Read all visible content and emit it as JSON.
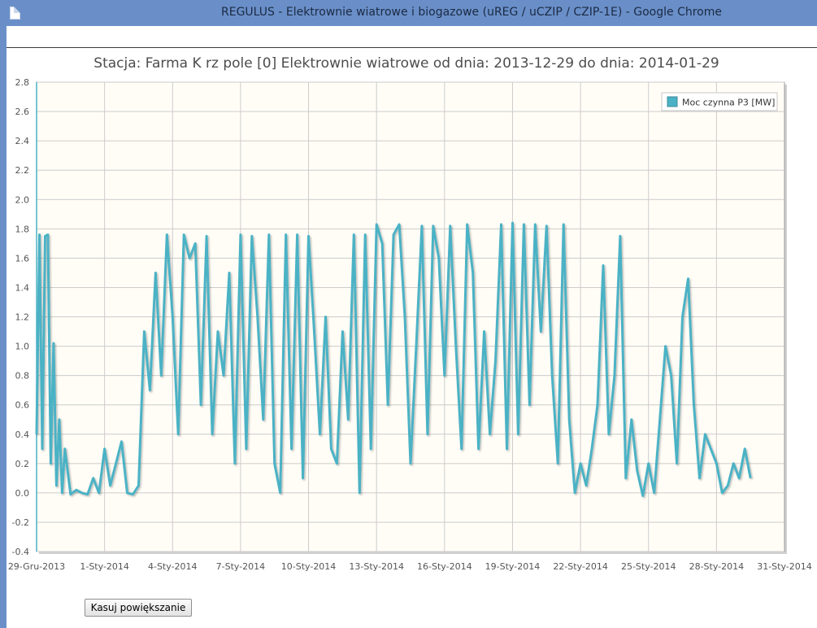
{
  "window": {
    "title": "REGULUS - Elektrownie wiatrowe i biogazowe (uREG / uCZIP / CZIP-1E) - Google Chrome"
  },
  "page": {
    "reset_zoom_label": "Kasuj powiększanie"
  },
  "colors": {
    "series": "#4bb2c5",
    "plot_bg": "#fffdf6",
    "grid": "#cccccc"
  },
  "chart_data": {
    "type": "line",
    "title": "Stacja: Farma K    rz pole [0] Elektrownie wiatrowe od dnia: 2013-12-29 do dnia: 2014-01-29",
    "xlabel": "",
    "ylabel": "",
    "xlim": [
      "2013-12-29",
      "2014-01-31"
    ],
    "ylim": [
      -0.4,
      2.8
    ],
    "grid": true,
    "legend": "top-right",
    "y_ticks": [
      "2.8",
      "2.6",
      "2.4",
      "2.2",
      "2.0",
      "1.8",
      "1.6",
      "1.4",
      "1.2",
      "1.0",
      "0.8",
      "0.6",
      "0.4",
      "0.2",
      "0.0",
      "-0.2",
      "-0.4"
    ],
    "x_ticks": [
      "29-Gru-2013",
      "1-Sty-2014",
      "4-Sty-2014",
      "7-Sty-2014",
      "10-Sty-2014",
      "13-Sty-2014",
      "16-Sty-2014",
      "19-Sty-2014",
      "22-Sty-2014",
      "25-Sty-2014",
      "28-Sty-2014",
      "31-Sty-2014"
    ],
    "series": [
      {
        "name": "Moc czynna P3 [MW]",
        "x": [
          "2013-12-29 00:00",
          "2013-12-29 03:00",
          "2013-12-29 06:00",
          "2013-12-29 09:00",
          "2013-12-29 12:00",
          "2013-12-29 15:00",
          "2013-12-29 18:00",
          "2013-12-29 21:00",
          "2013-12-30 00:00",
          "2013-12-30 03:00",
          "2013-12-30 06:00",
          "2013-12-30 12:00",
          "2013-12-30 18:00",
          "2013-12-31 00:00",
          "2013-12-31 06:00",
          "2013-12-31 12:00",
          "2013-12-31 18:00",
          "2014-01-01 00:00",
          "2014-01-01 06:00",
          "2014-01-01 12:00",
          "2014-01-01 18:00",
          "2014-01-02 00:00",
          "2014-01-02 06:00",
          "2014-01-02 12:00",
          "2014-01-02 18:00",
          "2014-01-03 00:00",
          "2014-01-03 06:00",
          "2014-01-03 12:00",
          "2014-01-03 18:00",
          "2014-01-04 00:00",
          "2014-01-04 06:00",
          "2014-01-04 12:00",
          "2014-01-04 18:00",
          "2014-01-05 00:00",
          "2014-01-05 06:00",
          "2014-01-05 12:00",
          "2014-01-05 18:00",
          "2014-01-06 00:00",
          "2014-01-06 06:00",
          "2014-01-06 12:00",
          "2014-01-06 18:00",
          "2014-01-07 00:00",
          "2014-01-07 06:00",
          "2014-01-07 12:00",
          "2014-01-07 18:00",
          "2014-01-08 00:00",
          "2014-01-08 06:00",
          "2014-01-08 12:00",
          "2014-01-08 18:00",
          "2014-01-09 00:00",
          "2014-01-09 06:00",
          "2014-01-09 12:00",
          "2014-01-09 18:00",
          "2014-01-10 00:00",
          "2014-01-10 06:00",
          "2014-01-10 12:00",
          "2014-01-10 18:00",
          "2014-01-11 00:00",
          "2014-01-11 06:00",
          "2014-01-11 12:00",
          "2014-01-11 18:00",
          "2014-01-12 00:00",
          "2014-01-12 06:00",
          "2014-01-12 12:00",
          "2014-01-12 18:00",
          "2014-01-13 00:00",
          "2014-01-13 06:00",
          "2014-01-13 12:00",
          "2014-01-13 18:00",
          "2014-01-14 00:00",
          "2014-01-14 06:00",
          "2014-01-14 12:00",
          "2014-01-14 18:00",
          "2014-01-15 00:00",
          "2014-01-15 06:00",
          "2014-01-15 12:00",
          "2014-01-15 18:00",
          "2014-01-16 00:00",
          "2014-01-16 06:00",
          "2014-01-16 12:00",
          "2014-01-16 18:00",
          "2014-01-17 00:00",
          "2014-01-17 06:00",
          "2014-01-17 12:00",
          "2014-01-17 18:00",
          "2014-01-18 00:00",
          "2014-01-18 06:00",
          "2014-01-18 12:00",
          "2014-01-18 18:00",
          "2014-01-19 00:00",
          "2014-01-19 06:00",
          "2014-01-19 12:00",
          "2014-01-19 18:00",
          "2014-01-20 00:00",
          "2014-01-20 06:00",
          "2014-01-20 12:00",
          "2014-01-20 18:00",
          "2014-01-21 00:00",
          "2014-01-21 06:00",
          "2014-01-21 12:00",
          "2014-01-21 18:00",
          "2014-01-22 00:00",
          "2014-01-22 06:00",
          "2014-01-22 12:00",
          "2014-01-22 18:00",
          "2014-01-23 00:00",
          "2014-01-23 06:00",
          "2014-01-23 12:00",
          "2014-01-23 18:00",
          "2014-01-24 00:00",
          "2014-01-24 06:00",
          "2014-01-24 12:00",
          "2014-01-24 18:00",
          "2014-01-25 00:00",
          "2014-01-25 06:00",
          "2014-01-25 12:00",
          "2014-01-25 18:00",
          "2014-01-26 00:00",
          "2014-01-26 06:00",
          "2014-01-26 12:00",
          "2014-01-26 18:00",
          "2014-01-27 00:00",
          "2014-01-27 06:00",
          "2014-01-27 12:00",
          "2014-01-27 18:00",
          "2014-01-28 00:00",
          "2014-01-28 06:00",
          "2014-01-28 12:00",
          "2014-01-28 18:00",
          "2014-01-29 00:00",
          "2014-01-29 06:00",
          "2014-01-29 12:00"
        ],
        "values": [
          0.4,
          1.76,
          0.3,
          1.75,
          1.76,
          0.2,
          1.02,
          0.05,
          0.5,
          0.0,
          0.3,
          -0.01,
          0.02,
          0.0,
          -0.01,
          0.1,
          0.0,
          0.3,
          0.05,
          0.2,
          0.35,
          0.0,
          -0.01,
          0.05,
          1.1,
          0.7,
          1.5,
          0.8,
          1.76,
          1.2,
          0.4,
          1.76,
          1.6,
          1.7,
          0.6,
          1.75,
          0.4,
          1.1,
          0.8,
          1.5,
          0.2,
          1.76,
          0.3,
          1.75,
          1.2,
          0.5,
          1.76,
          0.2,
          0.0,
          1.76,
          0.3,
          1.76,
          0.1,
          1.75,
          1.1,
          0.4,
          1.2,
          0.3,
          0.2,
          1.1,
          0.5,
          1.76,
          0.0,
          1.76,
          0.3,
          1.83,
          1.7,
          0.6,
          1.76,
          1.83,
          1.2,
          0.2,
          1.0,
          1.82,
          0.4,
          1.82,
          1.6,
          0.8,
          1.82,
          1.0,
          0.3,
          1.83,
          1.5,
          0.3,
          1.1,
          0.4,
          0.9,
          1.83,
          0.3,
          1.84,
          0.4,
          1.83,
          0.6,
          1.83,
          1.1,
          1.82,
          0.8,
          0.2,
          1.83,
          0.5,
          0.0,
          0.2,
          0.05,
          0.3,
          0.6,
          1.55,
          0.4,
          0.8,
          1.75,
          0.1,
          0.5,
          0.15,
          -0.02,
          0.2,
          0.0,
          0.5,
          1.0,
          0.8,
          0.2,
          1.2,
          1.46,
          0.6,
          0.1,
          0.4,
          0.3,
          0.2,
          0.0,
          0.05,
          0.2,
          0.1,
          0.3,
          0.1
        ]
      }
    ]
  }
}
